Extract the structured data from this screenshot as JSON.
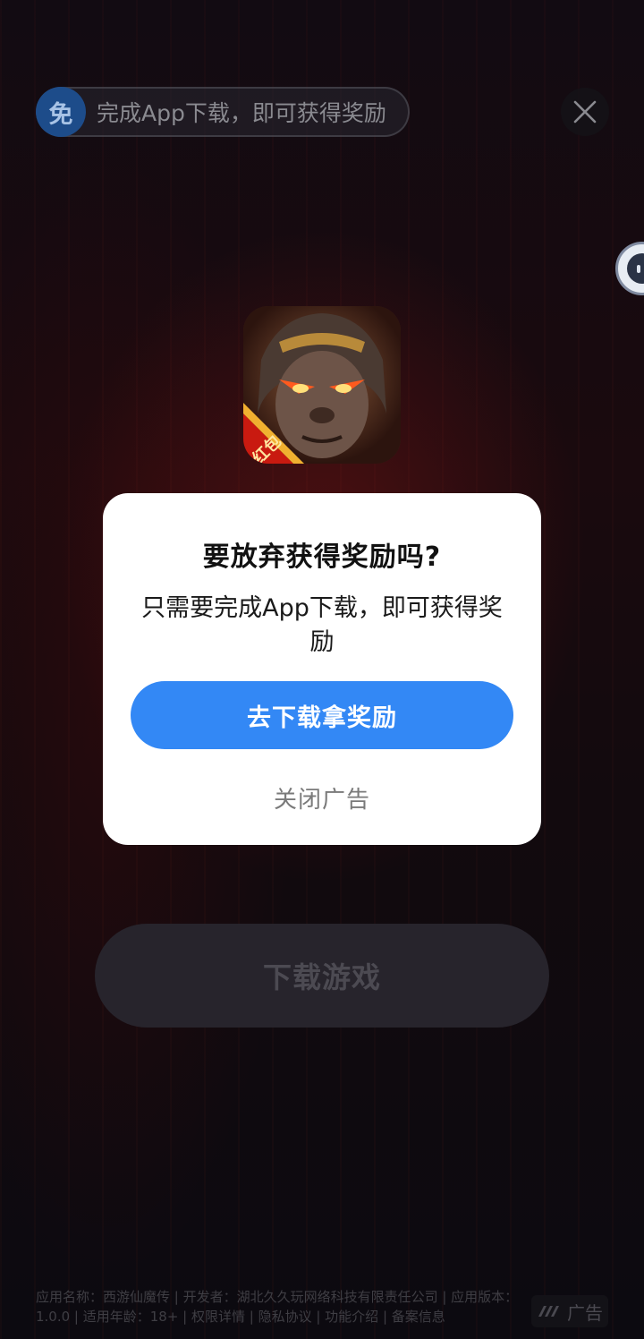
{
  "reward_banner": {
    "badge": "免",
    "text": "完成App下载，即可获得奖励"
  },
  "icons": {
    "close": "close-icon",
    "assistant": "chat-bubble-icon",
    "game": "game-app-icon",
    "ad_logo": "ad-logo-icon"
  },
  "game_icon": {
    "tag": "红包"
  },
  "dialog": {
    "title": "要放弃获得奖励吗?",
    "message": "只需要完成App下载，即可获得奖励",
    "primary_label": "去下载拿奖励",
    "secondary_label": "关闭广告"
  },
  "download_button": {
    "label": "下载游戏"
  },
  "footer": {
    "app_info": "应用名称：西游仙魔传 | 开发者：湖北久久玩网络科技有限责任公司 | 应用版本：1.0.0 | 适用年龄：18+ | 权限详情 | 隐私协议 | 功能介绍 | 备案信息",
    "ad_label": "广告"
  },
  "colors": {
    "primary": "#3388f5",
    "dialog_bg": "#ffffff",
    "badge_bg": "#1d4c8a"
  }
}
